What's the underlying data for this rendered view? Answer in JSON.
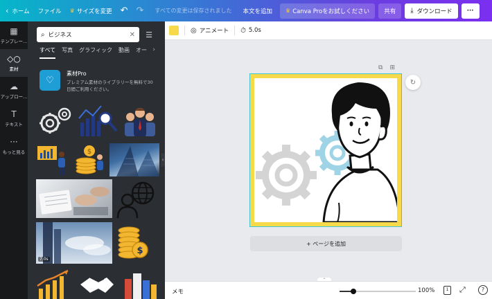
{
  "topbar": {
    "home": "ホーム",
    "file": "ファイル",
    "resize": "サイズを変更",
    "saved": "すべての変更は保存されました",
    "add_text": "本文を追加",
    "pro_trial": "Canva Proをお試しください",
    "share": "共有",
    "download": "ダウンロード",
    "more": "···"
  },
  "rail": {
    "items": [
      {
        "label": "テンプレー...",
        "icon": "template-icon"
      },
      {
        "label": "素材",
        "icon": "elements-icon"
      },
      {
        "label": "アップロー...",
        "icon": "upload-icon"
      },
      {
        "label": "テキスト",
        "icon": "text-icon"
      },
      {
        "label": "もっと見る",
        "icon": "more-icon"
      }
    ]
  },
  "panel": {
    "search_value": "ビジネス",
    "tabs": [
      "すべて",
      "写真",
      "グラフィック",
      "動画",
      "オー"
    ],
    "promo_title": "素材Pro",
    "promo_desc_line1": "プレミアム素材のライブラリーを無料で30",
    "promo_desc_line2": "日間ご利用ください。",
    "video_duration": "7.0s"
  },
  "context_toolbar": {
    "animate": "アニメート",
    "duration": "5.0s",
    "color": "#f7d94c"
  },
  "canvas": {
    "add_page": "+ ページを追加"
  },
  "bottombar": {
    "memo": "メモ",
    "zoom": "100%",
    "page_count": "1",
    "help": "?",
    "zoom_fraction": 0.18
  },
  "colors": {
    "accent_yellow": "#f7d94c",
    "selection_cyan": "#3fc5d8",
    "panel_bg": "#2b2e33",
    "rail_bg": "#18191b"
  }
}
